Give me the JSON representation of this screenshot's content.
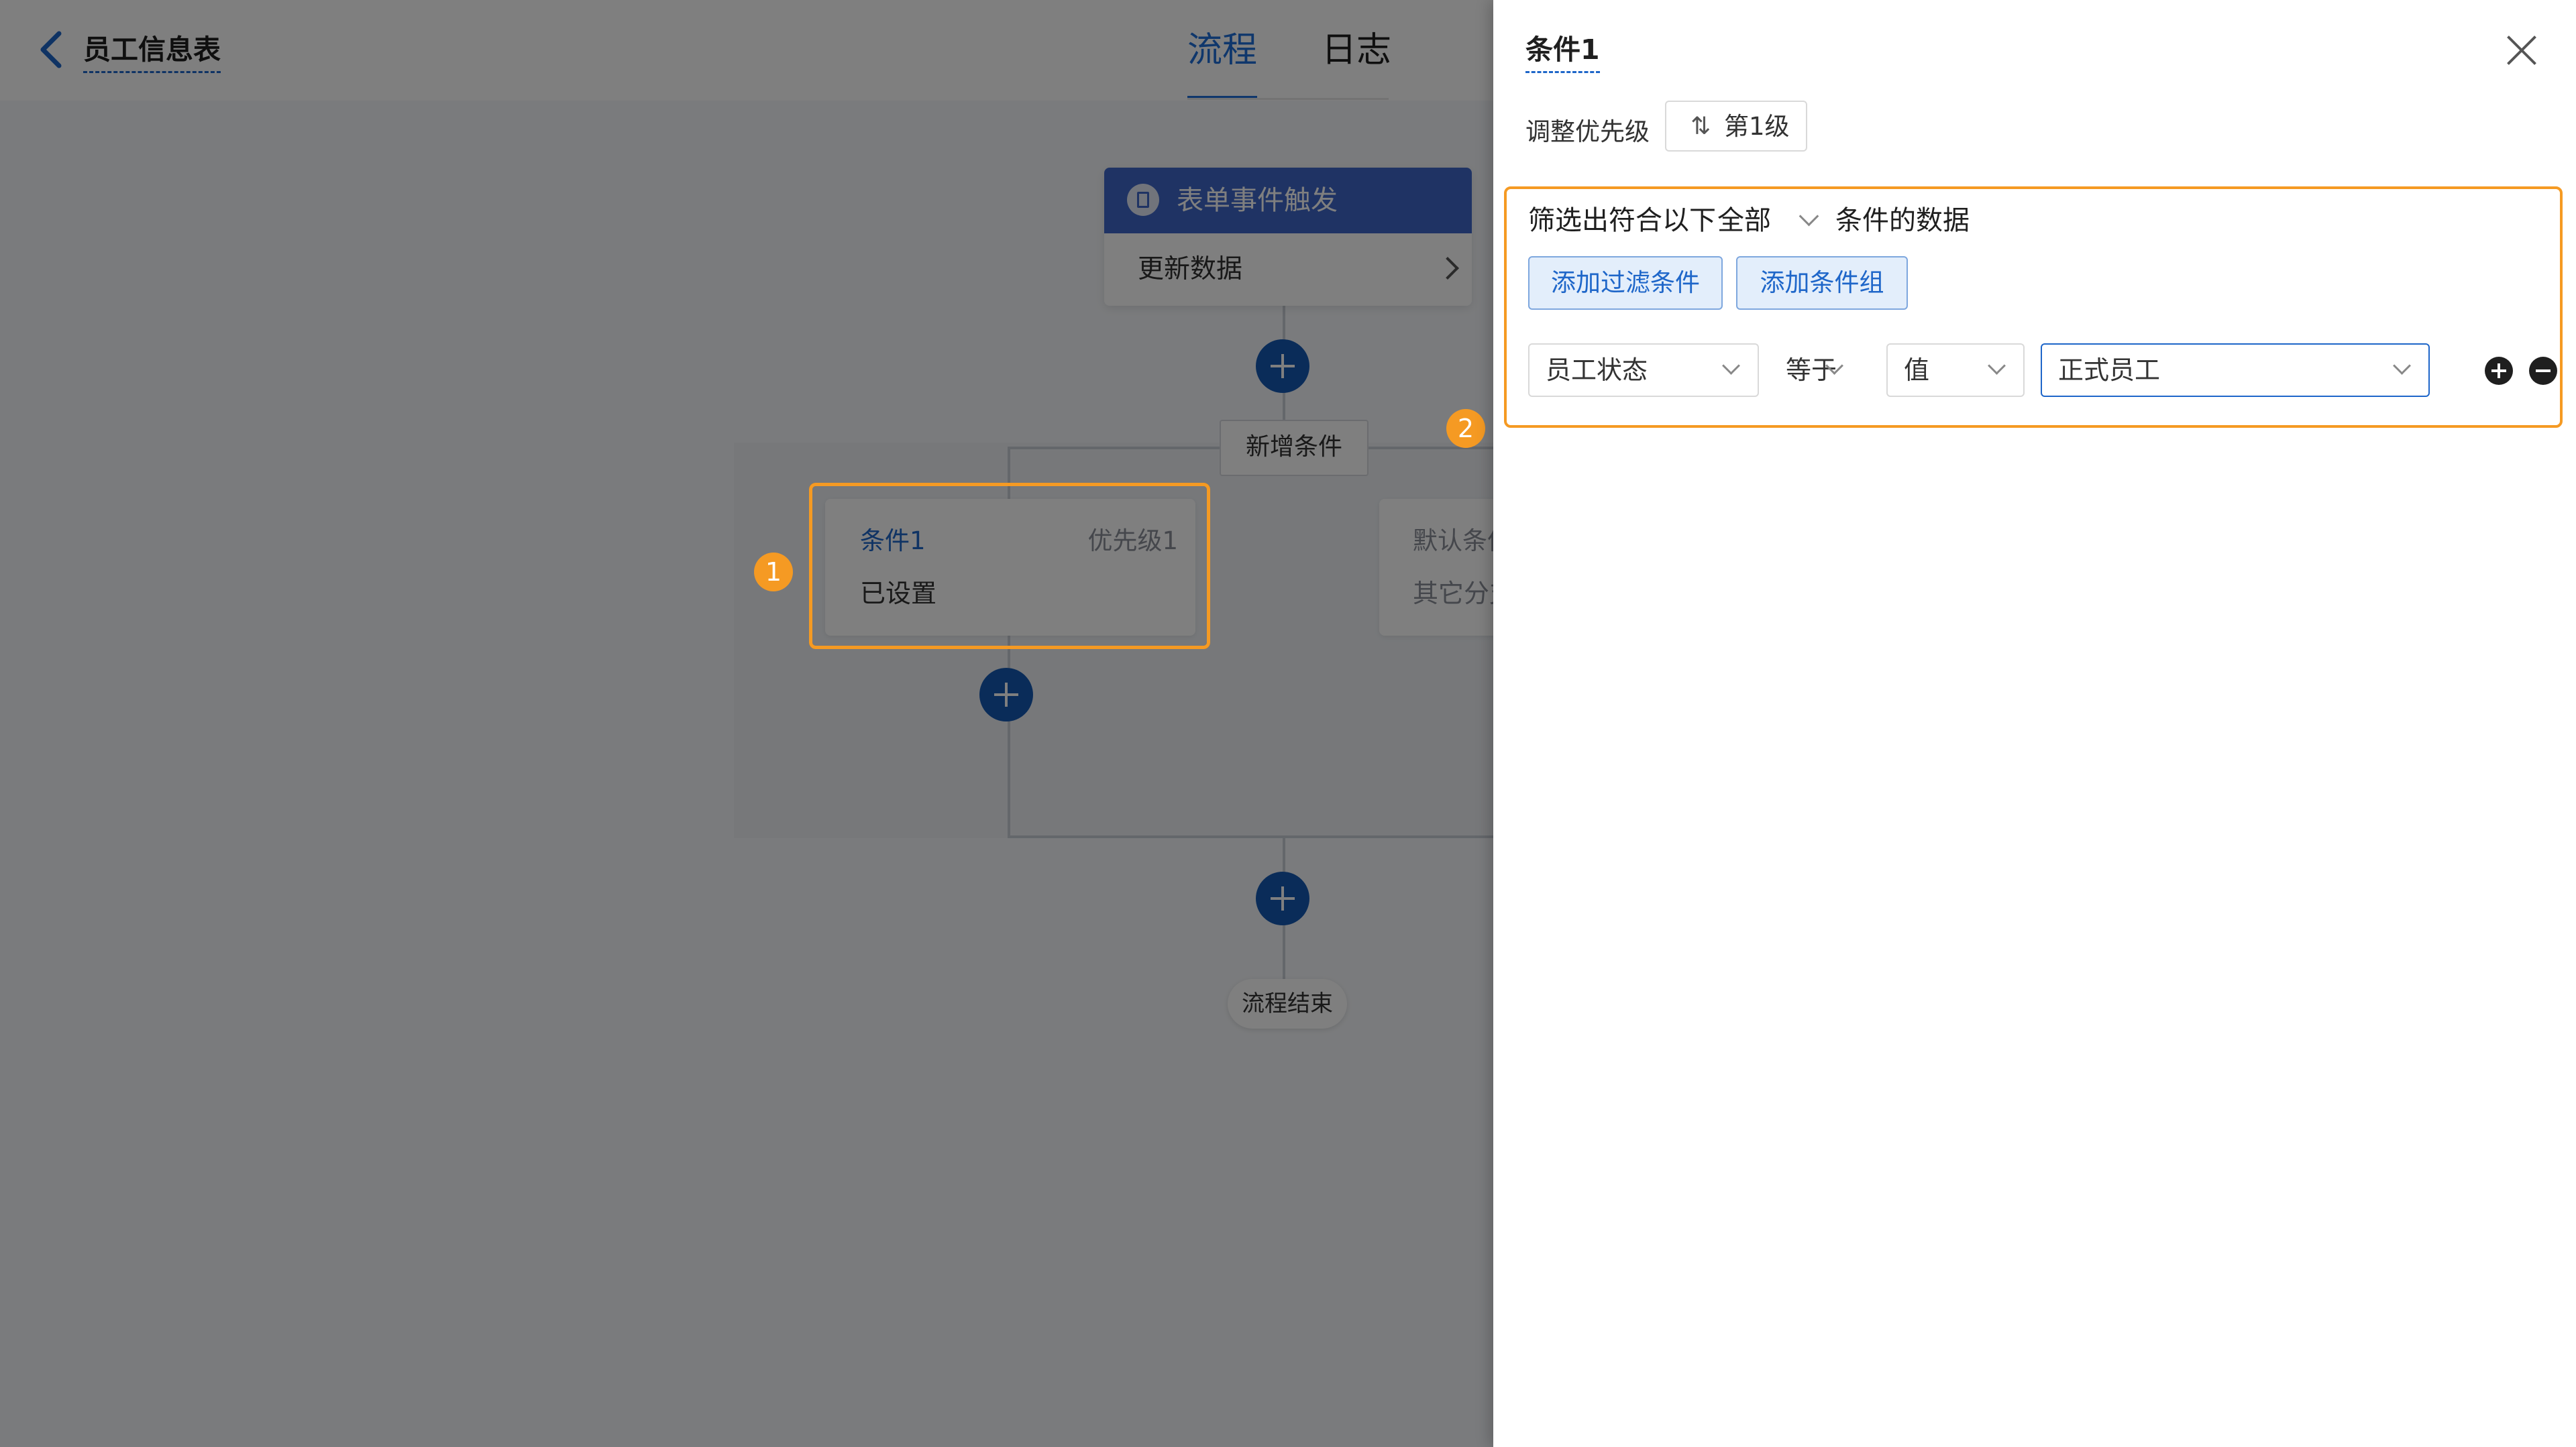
{
  "header": {
    "app_title": "员工信息表",
    "tabs": [
      {
        "label": "流程",
        "active": true
      },
      {
        "label": "日志",
        "active": false
      }
    ]
  },
  "flow": {
    "trigger": {
      "title": "表单事件触发",
      "action": "更新数据"
    },
    "add_condition_label": "新增条件",
    "condition_card": {
      "name": "条件1",
      "priority": "优先级1",
      "state": "已设置"
    },
    "default_card": {
      "name": "默认条件",
      "state": "其它分支"
    },
    "end_label": "流程结束",
    "badges": [
      "1",
      "2"
    ]
  },
  "panel": {
    "title": "条件1",
    "priority_label": "调整优先级",
    "priority_value": "第1级",
    "filter": {
      "prefix": "筛选出符合以下",
      "match_mode": "全部",
      "suffix": "条件的数据",
      "add_filter_label": "添加过滤条件",
      "add_group_label": "添加条件组",
      "rule": {
        "field": "员工状态",
        "operator": "等于",
        "value_type": "值",
        "value": "正式员工"
      }
    }
  },
  "colors": {
    "accent": "#1f6fd8",
    "highlight": "#f59a23",
    "plus_button": "#1559b3"
  }
}
